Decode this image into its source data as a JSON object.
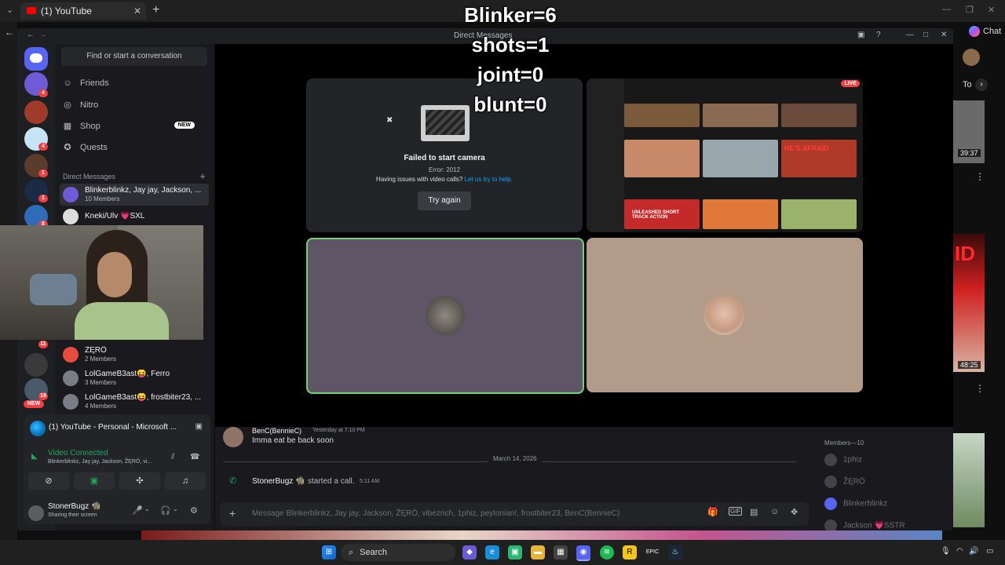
{
  "browser": {
    "tab_title": "(1) YouTube",
    "chat_label": "Chat"
  },
  "counters": {
    "blinker": "Blinker=6",
    "shots": "shots=1",
    "joint": "joint=0",
    "blunt": "blunt=0"
  },
  "discord": {
    "window_title": "Direct Messages",
    "search_placeholder": "Find or start a conversation",
    "nav": [
      {
        "label": "Friends",
        "icon": "friends-icon"
      },
      {
        "label": "Nitro",
        "icon": "nitro-icon"
      },
      {
        "label": "Shop",
        "icon": "shop-icon",
        "badge": "NEW"
      },
      {
        "label": "Quests",
        "icon": "quests-icon"
      }
    ],
    "dm_header": "Direct Messages",
    "dms": [
      {
        "name": "Blinkerblinkz, Jay jay, Jackson, ...",
        "sub": "10 Members"
      },
      {
        "name": "Kneki/Ulv 💗SXL",
        "sub": ""
      },
      {
        "name": "ŽĘRÖ",
        "sub": "2 Members"
      },
      {
        "name": "LolGameB3ast😝, Ferro",
        "sub": "3 Members"
      },
      {
        "name": "LolGameB3ast😝, frostbiter23, ...",
        "sub": "4 Members"
      }
    ],
    "guild_badges": [
      "4",
      "1",
      "8",
      "11",
      "18",
      "NEW"
    ],
    "activity": "(1) YouTube - Personal - Microsoft ...",
    "voice_status": "Video Connected",
    "voice_sub": "Blinkerblinkz, Jay jay, Jackson, ŽĘRÖ, vi...",
    "user": {
      "name": "StonerBugz 🧌",
      "status": "Sharing their screen"
    },
    "camera": {
      "title": "Failed to start camera",
      "error": "Error: 2012",
      "help_prefix": "Having issues with video calls?",
      "help_link": "Let us try to help.",
      "retry": "Try again"
    },
    "live_badge": "LIVE",
    "stream_thumb_texts": [
      "HE'S AFRAID",
      "UNLEASHED SHORT TRACK ACTION"
    ],
    "chat": {
      "msg_author": "BenC(BennieC)",
      "msg_time": "Yesterday at 7:10 PM",
      "msg_text": "Imma eat be back soon",
      "date_divider": "March 14, 2026",
      "call_user": "StonerBugz 🧌",
      "call_text": "started a call.",
      "call_time": "5:11 AM",
      "composer_placeholder": "Message Blinkerblinkz, Jay jay, Jackson, ŽĘRÖ, vibezrich, 1phiz, peytonian!, frostbiter23, BenC(BennieC)"
    },
    "members": {
      "header": "Members—10",
      "list": [
        "1phiz",
        "ŽĘRÖ",
        "Blinkerblinkz",
        "Jackson 💗SSTR"
      ]
    }
  },
  "youtube_side": {
    "dur1": "39:37",
    "dur2": "48:25",
    "chip": "To"
  },
  "taskbar": {
    "search": "Search"
  },
  "colors": {
    "discord_blurple": "#5865f2",
    "voice_green": "#23a55a",
    "live_red": "#f23f43",
    "speaking_border": "#6fd66f"
  }
}
